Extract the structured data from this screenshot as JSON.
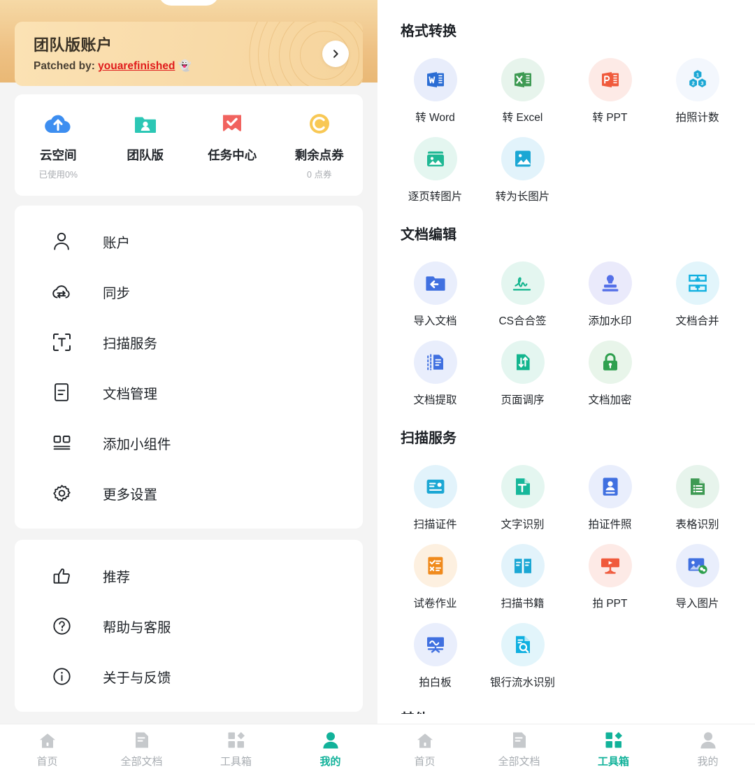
{
  "colors": {
    "accent": "#12b29a",
    "gold_dark": "#e9b875",
    "gold_card": "#f9dcab",
    "patch_link": "#e01b1b",
    "inactive_tab": "#a8adb2"
  },
  "left": {
    "vip": {
      "title": "团队版账户",
      "subtitle_prefix": "Patched by:",
      "subtitle_link": "youarefinished",
      "subtitle_emoji": "👻",
      "arrow_icon": "chevron-right-icon"
    },
    "stats": [
      {
        "label": "云空间",
        "sub": "已使用0%",
        "icon": "cloud-upload-icon"
      },
      {
        "label": "团队版",
        "sub": "",
        "icon": "team-folder-icon"
      },
      {
        "label": "任务中心",
        "sub": "",
        "icon": "task-check-icon"
      },
      {
        "label": "剩余点券",
        "sub": "0 点券",
        "icon": "coupon-coin-icon"
      }
    ],
    "menu_primary": [
      {
        "label": "账户",
        "icon": "user-icon"
      },
      {
        "label": "同步",
        "icon": "cloud-sync-icon"
      },
      {
        "label": "扫描服务",
        "icon": "scan-text-icon"
      },
      {
        "label": "文档管理",
        "icon": "document-icon"
      },
      {
        "label": "添加小组件",
        "icon": "widget-icon"
      },
      {
        "label": "更多设置",
        "icon": "gear-icon"
      }
    ],
    "menu_secondary": [
      {
        "label": "推荐",
        "icon": "thumbs-up-icon"
      },
      {
        "label": "帮助与客服",
        "icon": "help-circle-icon"
      },
      {
        "label": "关于与反馈",
        "icon": "info-circle-icon"
      }
    ],
    "tabs": [
      {
        "label": "首页",
        "icon": "home-icon",
        "active": false
      },
      {
        "label": "全部文档",
        "icon": "documents-icon",
        "active": false
      },
      {
        "label": "工具箱",
        "icon": "toolbox-icon",
        "active": false
      },
      {
        "label": "我的",
        "icon": "profile-icon",
        "active": true
      }
    ]
  },
  "right": {
    "sections": [
      {
        "title": "格式转换",
        "tools": [
          {
            "label": "转 Word",
            "icon": "word-icon",
            "bubble": "#e8edfb",
            "fg": "#2b6dd4"
          },
          {
            "label": "转 Excel",
            "icon": "excel-icon",
            "bubble": "#e7f4ec",
            "fg": "#3e9a53"
          },
          {
            "label": "转 PPT",
            "icon": "ppt-icon",
            "bubble": "#fdeae6",
            "fg": "#f05a3c"
          },
          {
            "label": "拍照计数",
            "icon": "photo-count-icon",
            "bubble": "#f3f7fd",
            "fg": "#1ba7d4"
          },
          {
            "label": "逐页转图片",
            "icon": "pages-to-image-icon",
            "bubble": "#e4f6f0",
            "fg": "#1fb894"
          },
          {
            "label": "转为长图片",
            "icon": "long-image-icon",
            "bubble": "#e2f3fb",
            "fg": "#1ba7d4"
          }
        ]
      },
      {
        "title": "文档编辑",
        "tools": [
          {
            "label": "导入文档",
            "icon": "import-doc-icon",
            "bubble": "#e9eefc",
            "fg": "#4070e0"
          },
          {
            "label": "CS合合签",
            "icon": "signature-icon",
            "bubble": "#e4f6f0",
            "fg": "#13b58e"
          },
          {
            "label": "添加水印",
            "icon": "stamp-icon",
            "bubble": "#eaeafb",
            "fg": "#5570e8"
          },
          {
            "label": "文档合并",
            "icon": "merge-doc-icon",
            "bubble": "#e2f5fb",
            "fg": "#10b0e0"
          },
          {
            "label": "文档提取",
            "icon": "extract-doc-icon",
            "bubble": "#e9eefc",
            "fg": "#4070e0"
          },
          {
            "label": "页面调序",
            "icon": "reorder-pages-icon",
            "bubble": "#e4f6f0",
            "fg": "#13b58e"
          },
          {
            "label": "文档加密",
            "icon": "lock-icon",
            "bubble": "#e8f5ea",
            "fg": "#2fa04f"
          }
        ]
      },
      {
        "title": "扫描服务",
        "tools": [
          {
            "label": "扫描证件",
            "icon": "scan-id-icon",
            "bubble": "#e2f3fb",
            "fg": "#1ba7d4"
          },
          {
            "label": "文字识别",
            "icon": "ocr-text-icon",
            "bubble": "#e4f6f0",
            "fg": "#16b79a"
          },
          {
            "label": "拍证件照",
            "icon": "id-photo-icon",
            "bubble": "#e9eefc",
            "fg": "#4070e0"
          },
          {
            "label": "表格识别",
            "icon": "table-ocr-icon",
            "bubble": "#e7f4ec",
            "fg": "#3e9a53"
          },
          {
            "label": "试卷作业",
            "icon": "exam-paper-icon",
            "bubble": "#fdf0e0",
            "fg": "#f08a1c"
          },
          {
            "label": "扫描书籍",
            "icon": "scan-book-icon",
            "bubble": "#e2f3fb",
            "fg": "#1ba7d4"
          },
          {
            "label": "拍 PPT",
            "icon": "shoot-ppt-icon",
            "bubble": "#fdeae6",
            "fg": "#f05a3c"
          },
          {
            "label": "导入图片",
            "icon": "import-image-icon",
            "bubble": "#e9eefc",
            "fg": "#4070e0"
          },
          {
            "label": "拍白板",
            "icon": "whiteboard-icon",
            "bubble": "#e9eefc",
            "fg": "#4070e0"
          },
          {
            "label": "银行流水识别",
            "icon": "bank-statement-icon",
            "bubble": "#e2f5fb",
            "fg": "#10b0e0"
          }
        ]
      }
    ],
    "cut_title": "其他",
    "tabs": [
      {
        "label": "首页",
        "icon": "home-icon",
        "active": false
      },
      {
        "label": "全部文档",
        "icon": "documents-icon",
        "active": false
      },
      {
        "label": "工具箱",
        "icon": "toolbox-icon",
        "active": true
      },
      {
        "label": "我的",
        "icon": "profile-icon",
        "active": false
      }
    ]
  }
}
